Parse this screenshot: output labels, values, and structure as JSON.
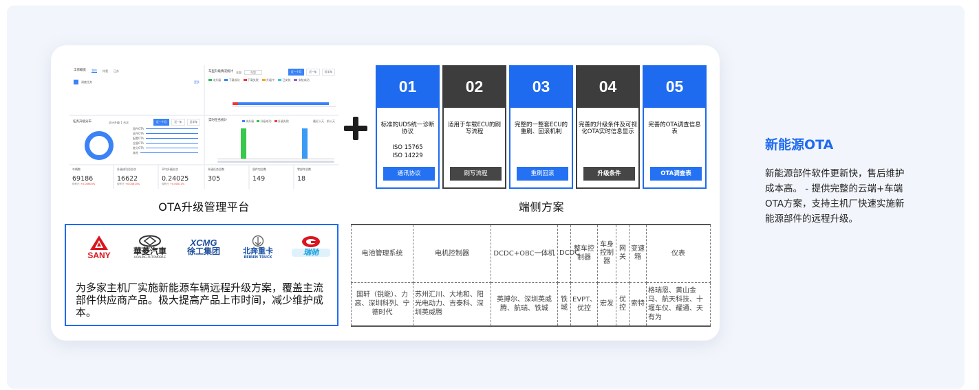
{
  "dashboard": {
    "work_panel": {
      "title": "工作概览",
      "tabs": [
        "我的",
        "待我",
        "已办"
      ],
      "item": "调度任务",
      "link": "更多"
    },
    "status_panel": {
      "title": "车型升级情况统计",
      "filters": [
        "全部",
        "车型"
      ],
      "tabs": [
        "近一个月",
        "近一年",
        "近半年",
        "近一月"
      ],
      "legend": [
        "未升级",
        "下载成功",
        "下载失败",
        "升级中",
        "已安装",
        "安装成功",
        "升级成功",
        "升级失败"
      ]
    },
    "ring_panel": {
      "title": "任务升级分布",
      "subtitle": "总计升级 1 台次",
      "tabs": [
        "近一个月",
        "近一年",
        "近半年"
      ],
      "rows": [
        "固件OTA",
        "软件OTA",
        "配置OTA",
        "全量OTA",
        "差分OTA",
        "其他"
      ]
    },
    "bar_panel": {
      "title": "实时任务统计",
      "legend": [
        "待升级",
        "升级成功",
        "升级失败"
      ],
      "nav": [
        "最近十天",
        "前十天"
      ]
    },
    "stats": [
      {
        "label": "车辆数",
        "value": "69186",
        "change_label": "较昨日",
        "change": "+0.03603%"
      },
      {
        "label": "升级成功总台次",
        "value": "16622",
        "change_label": "较昨日",
        "change": "+0.04613%"
      },
      {
        "label": "平均升级台次",
        "value": "0.24025",
        "change_label": "较昨日",
        "change": "+0.00011%"
      },
      {
        "label": "升级任务总数",
        "value": "305",
        "change_label": "",
        "change": ""
      },
      {
        "label": "固件包总数",
        "value": "149",
        "change_label": "",
        "change": ""
      },
      {
        "label": "零部件总数",
        "value": "18",
        "change_label": "",
        "change": ""
      }
    ]
  },
  "dashboard_caption": "OTA升级管理平台",
  "steps": [
    {
      "number": "01",
      "desc": "标准的UDS统一诊断协议",
      "extra": "ISO 15765\nISO 14229",
      "button": "通讯协议",
      "style": "blue"
    },
    {
      "number": "02",
      "desc": "适用于车载ECU的刷写流程",
      "extra": "",
      "button": "刷写流程",
      "style": "dark"
    },
    {
      "number": "03",
      "desc": "完整的一整套ECU的重刷、回滚机制",
      "extra": "",
      "button": "重刷回滚",
      "style": "blue"
    },
    {
      "number": "04",
      "desc": "完善的升级条件及可视化OTA实时信息显示",
      "extra": "",
      "button": "升级条件",
      "style": "dark"
    },
    {
      "number": "05",
      "desc": "完善的OTA调查信息表",
      "extra": "",
      "button": "OTA调查表",
      "style": "blue"
    }
  ],
  "steps_caption": "端侧方案",
  "logos": [
    {
      "name": "SANY",
      "icon": "sany-logo"
    },
    {
      "name": "華菱汽車",
      "sub": "HUALING AUTOMOBILE",
      "icon": "hualing-logo"
    },
    {
      "name": "XCMG",
      "sub": "徐工集团",
      "icon": "xcmg-logo"
    },
    {
      "name": "北奔重卡",
      "sub": "BEIBEN TRUCK",
      "icon": "beiben-logo"
    },
    {
      "name": "瑞驰",
      "icon": "ruichi-logo"
    }
  ],
  "logos_text": "为多家主机厂实施新能源车辆远程升级方案，覆盖主流部件供应商产品。极大提高产品上市时间，减少维护成本。",
  "table": {
    "headers": [
      "电池管理系统",
      "电机控制器",
      "DCDC+OBC一体机",
      "DCDC",
      "整车控制器",
      "车身控制器",
      "网关",
      "变速箱",
      "仪表"
    ],
    "values": [
      "国轩（锐能）、力高、深圳科列、宁德时代",
      "苏州汇川、大地和、阳光电动力、吉泰科、深圳英威腾",
      "英搏尔、深圳英威腾、航瑞、铁城",
      "铁城",
      "EVPT、优控",
      "宏发",
      "优控",
      "索特",
      "格瑞恩、黄山金马、航天科技、十堰车仪、耀通、天有为"
    ]
  },
  "side": {
    "title": "新能源OTA",
    "text": "新能源部件软件更新快，售后维护成本高。 - 提供完整的云端+车端OTA方案，支持主机厂快速实施新能源部件的远程升级。"
  },
  "colors": {
    "accent": "#1e6bf0",
    "dark_step": "#3d3d3d",
    "background": "#f2f5fb"
  }
}
